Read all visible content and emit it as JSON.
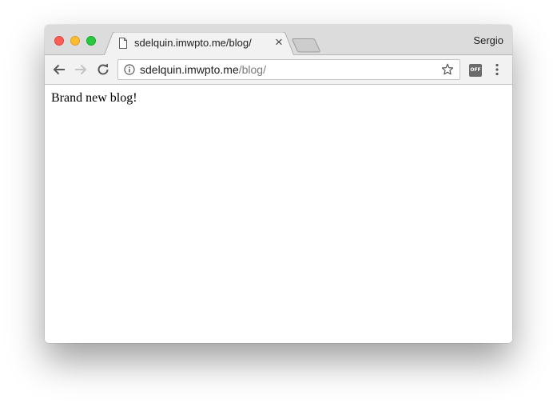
{
  "browser": {
    "tab": {
      "title": "sdelquin.imwpto.me/blog/",
      "close_glyph": "×",
      "icon": "document-icon"
    },
    "profile_name": "Sergio",
    "address_bar": {
      "host": "sdelquin.imwpto.me",
      "path": "/blog/",
      "info_icon": "info-icon",
      "bookmark_icon": "star-icon"
    },
    "extension_label": "OFF",
    "nav_icons": [
      "back-arrow-icon",
      "forward-arrow-icon",
      "reload-icon"
    ],
    "menu_icon": "kebab-menu-icon"
  },
  "page": {
    "body_text": "Brand new blog!"
  },
  "colors": {
    "close": "#fd5f57",
    "minimize": "#febc2e",
    "maximize": "#28c840",
    "url_path": "#7a7a7a"
  }
}
